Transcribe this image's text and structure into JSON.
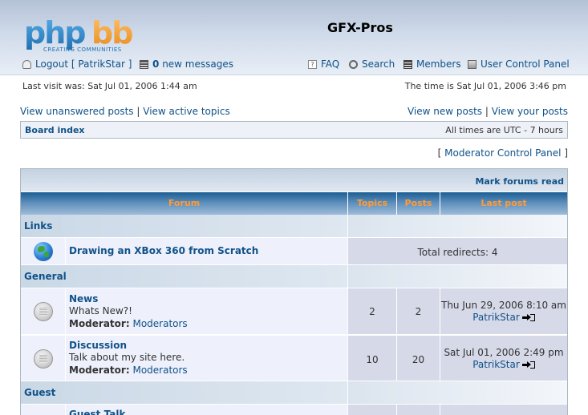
{
  "header": {
    "logo_text": "phpbb",
    "logo_tagline": "CREATING COMMUNITIES",
    "site_name": "GFX-Pros",
    "logout_label": "Logout [ PatrikStar ]",
    "messages_count": "0",
    "messages_label": "new messages",
    "nav": {
      "faq": "FAQ",
      "search": "Search",
      "members": "Members",
      "ucp": "User Control Panel"
    }
  },
  "info": {
    "last_visit": "Last visit was: Sat Jul 01, 2006 1:44 am",
    "current_time": "The time is Sat Jul 01, 2006 3:46 pm"
  },
  "quick_links": {
    "unanswered": "View unanswered posts",
    "active": "View active topics",
    "new_posts": "View new posts",
    "your_posts": "View your posts",
    "separator": "|"
  },
  "breadcrumb": {
    "board_index": "Board index",
    "timezone": "All times are UTC - 7 hours"
  },
  "moderator_cp": {
    "open": "[",
    "label": "Moderator Control Panel",
    "close": "]"
  },
  "forum_table": {
    "mark_read": "Mark forums read",
    "columns": {
      "forum": "Forum",
      "topics": "Topics",
      "posts": "Posts",
      "last_post": "Last post"
    },
    "moderator_label": "Moderator:",
    "categories": [
      {
        "name": "Links",
        "forums": [
          {
            "title": "Drawing an XBox 360 from Scratch",
            "redirects": "Total redirects: 4"
          }
        ]
      },
      {
        "name": "General",
        "forums": [
          {
            "title": "News",
            "description": "Whats New?!",
            "moderator": "Moderators",
            "topics": "2",
            "posts": "2",
            "last_post_time": "Thu Jun 29, 2006 8:10 am",
            "last_post_user": "PatrikStar"
          },
          {
            "title": "Discussion",
            "description": "Talk about my site here.",
            "moderator": "Moderators",
            "topics": "10",
            "posts": "20",
            "last_post_time": "Sat Jul 01, 2006 2:49 pm",
            "last_post_user": "PatrikStar"
          }
        ]
      },
      {
        "name": "Guest",
        "forums": [
          {
            "title": "Guest Talk"
          }
        ]
      }
    ]
  },
  "icons": {
    "logout": "padlock-icon",
    "messages": "message-list-icon",
    "faq": "faq-icon",
    "search": "magnifier-icon",
    "members": "member-list-icon",
    "ucp": "user-control-panel-icon",
    "forum_link": "globe-icon",
    "forum_read": "forum-read-icon",
    "goto_last_post": "goto-last-post-icon"
  },
  "colors": {
    "link": "#105289",
    "header_column_text": "#ff9b38",
    "row_bg": "#eef0fb",
    "stat_bg": "#d6d9e8"
  }
}
